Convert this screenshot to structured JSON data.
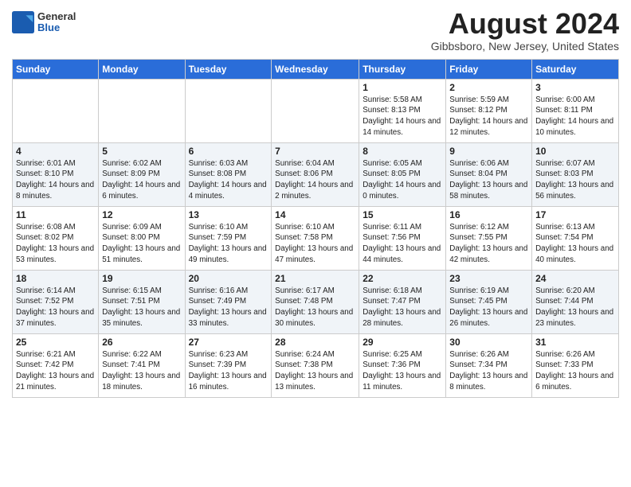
{
  "header": {
    "logo_general": "General",
    "logo_blue": "Blue",
    "month_title": "August 2024",
    "location": "Gibbsboro, New Jersey, United States"
  },
  "days_of_week": [
    "Sunday",
    "Monday",
    "Tuesday",
    "Wednesday",
    "Thursday",
    "Friday",
    "Saturday"
  ],
  "weeks": [
    [
      {
        "day": "",
        "info": ""
      },
      {
        "day": "",
        "info": ""
      },
      {
        "day": "",
        "info": ""
      },
      {
        "day": "",
        "info": ""
      },
      {
        "day": "1",
        "info": "Sunrise: 5:58 AM\nSunset: 8:13 PM\nDaylight: 14 hours and 14 minutes."
      },
      {
        "day": "2",
        "info": "Sunrise: 5:59 AM\nSunset: 8:12 PM\nDaylight: 14 hours and 12 minutes."
      },
      {
        "day": "3",
        "info": "Sunrise: 6:00 AM\nSunset: 8:11 PM\nDaylight: 14 hours and 10 minutes."
      }
    ],
    [
      {
        "day": "4",
        "info": "Sunrise: 6:01 AM\nSunset: 8:10 PM\nDaylight: 14 hours and 8 minutes."
      },
      {
        "day": "5",
        "info": "Sunrise: 6:02 AM\nSunset: 8:09 PM\nDaylight: 14 hours and 6 minutes."
      },
      {
        "day": "6",
        "info": "Sunrise: 6:03 AM\nSunset: 8:08 PM\nDaylight: 14 hours and 4 minutes."
      },
      {
        "day": "7",
        "info": "Sunrise: 6:04 AM\nSunset: 8:06 PM\nDaylight: 14 hours and 2 minutes."
      },
      {
        "day": "8",
        "info": "Sunrise: 6:05 AM\nSunset: 8:05 PM\nDaylight: 14 hours and 0 minutes."
      },
      {
        "day": "9",
        "info": "Sunrise: 6:06 AM\nSunset: 8:04 PM\nDaylight: 13 hours and 58 minutes."
      },
      {
        "day": "10",
        "info": "Sunrise: 6:07 AM\nSunset: 8:03 PM\nDaylight: 13 hours and 56 minutes."
      }
    ],
    [
      {
        "day": "11",
        "info": "Sunrise: 6:08 AM\nSunset: 8:02 PM\nDaylight: 13 hours and 53 minutes."
      },
      {
        "day": "12",
        "info": "Sunrise: 6:09 AM\nSunset: 8:00 PM\nDaylight: 13 hours and 51 minutes."
      },
      {
        "day": "13",
        "info": "Sunrise: 6:10 AM\nSunset: 7:59 PM\nDaylight: 13 hours and 49 minutes."
      },
      {
        "day": "14",
        "info": "Sunrise: 6:10 AM\nSunset: 7:58 PM\nDaylight: 13 hours and 47 minutes."
      },
      {
        "day": "15",
        "info": "Sunrise: 6:11 AM\nSunset: 7:56 PM\nDaylight: 13 hours and 44 minutes."
      },
      {
        "day": "16",
        "info": "Sunrise: 6:12 AM\nSunset: 7:55 PM\nDaylight: 13 hours and 42 minutes."
      },
      {
        "day": "17",
        "info": "Sunrise: 6:13 AM\nSunset: 7:54 PM\nDaylight: 13 hours and 40 minutes."
      }
    ],
    [
      {
        "day": "18",
        "info": "Sunrise: 6:14 AM\nSunset: 7:52 PM\nDaylight: 13 hours and 37 minutes."
      },
      {
        "day": "19",
        "info": "Sunrise: 6:15 AM\nSunset: 7:51 PM\nDaylight: 13 hours and 35 minutes."
      },
      {
        "day": "20",
        "info": "Sunrise: 6:16 AM\nSunset: 7:49 PM\nDaylight: 13 hours and 33 minutes."
      },
      {
        "day": "21",
        "info": "Sunrise: 6:17 AM\nSunset: 7:48 PM\nDaylight: 13 hours and 30 minutes."
      },
      {
        "day": "22",
        "info": "Sunrise: 6:18 AM\nSunset: 7:47 PM\nDaylight: 13 hours and 28 minutes."
      },
      {
        "day": "23",
        "info": "Sunrise: 6:19 AM\nSunset: 7:45 PM\nDaylight: 13 hours and 26 minutes."
      },
      {
        "day": "24",
        "info": "Sunrise: 6:20 AM\nSunset: 7:44 PM\nDaylight: 13 hours and 23 minutes."
      }
    ],
    [
      {
        "day": "25",
        "info": "Sunrise: 6:21 AM\nSunset: 7:42 PM\nDaylight: 13 hours and 21 minutes."
      },
      {
        "day": "26",
        "info": "Sunrise: 6:22 AM\nSunset: 7:41 PM\nDaylight: 13 hours and 18 minutes."
      },
      {
        "day": "27",
        "info": "Sunrise: 6:23 AM\nSunset: 7:39 PM\nDaylight: 13 hours and 16 minutes."
      },
      {
        "day": "28",
        "info": "Sunrise: 6:24 AM\nSunset: 7:38 PM\nDaylight: 13 hours and 13 minutes."
      },
      {
        "day": "29",
        "info": "Sunrise: 6:25 AM\nSunset: 7:36 PM\nDaylight: 13 hours and 11 minutes."
      },
      {
        "day": "30",
        "info": "Sunrise: 6:26 AM\nSunset: 7:34 PM\nDaylight: 13 hours and 8 minutes."
      },
      {
        "day": "31",
        "info": "Sunrise: 6:26 AM\nSunset: 7:33 PM\nDaylight: 13 hours and 6 minutes."
      }
    ]
  ]
}
